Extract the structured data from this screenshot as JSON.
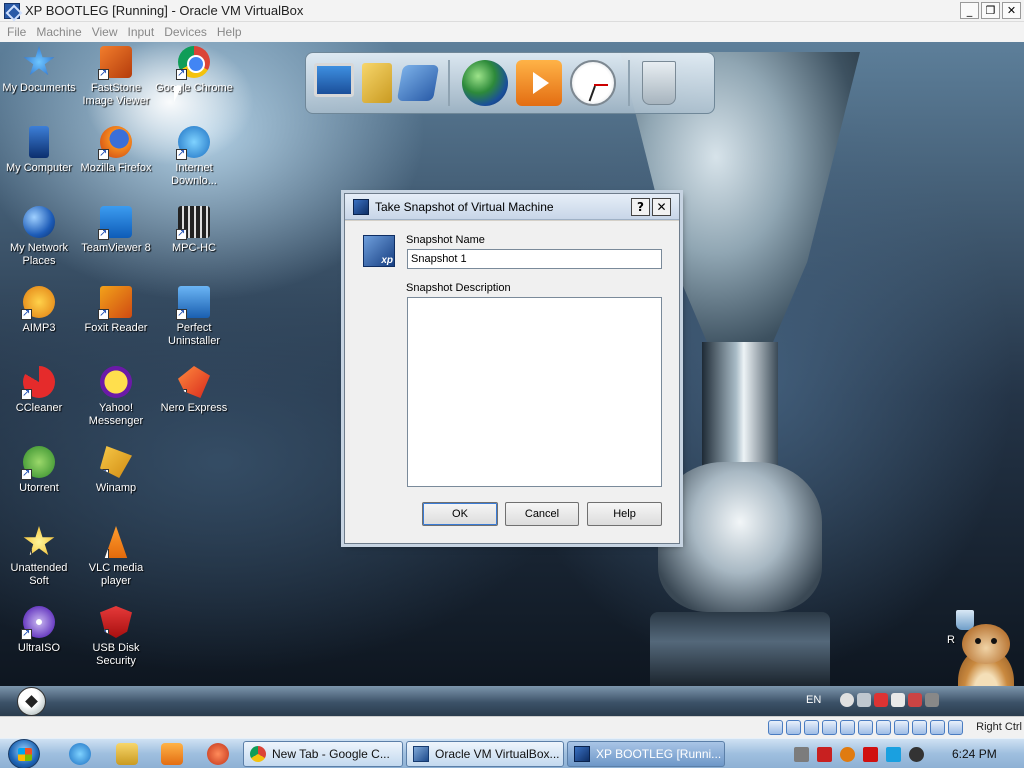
{
  "window": {
    "title": "XP BOOTLEG [Running] - Oracle VM VirtualBox",
    "minimize": "_",
    "restore": "❐",
    "close": "✕"
  },
  "menu": [
    "File",
    "Machine",
    "View",
    "Input",
    "Devices",
    "Help"
  ],
  "desktop_icons": [
    {
      "label": "My Documents",
      "icon": "my-documents-icon"
    },
    {
      "label": "FastStone Image Viewer",
      "icon": "faststone-icon"
    },
    {
      "label": "Google Chrome",
      "icon": "chrome-icon"
    },
    {
      "label": "My Computer",
      "icon": "my-computer-icon"
    },
    {
      "label": "Mozilla Firefox",
      "icon": "firefox-icon"
    },
    {
      "label": "Internet Downlo...",
      "icon": "internet-download-manager-icon"
    },
    {
      "label": "My Network Places",
      "icon": "network-places-icon"
    },
    {
      "label": "TeamViewer 8",
      "icon": "teamviewer-icon"
    },
    {
      "label": "MPC-HC",
      "icon": "mpc-hc-icon"
    },
    {
      "label": "AIMP3",
      "icon": "aimp-icon"
    },
    {
      "label": "Foxit Reader",
      "icon": "foxit-icon"
    },
    {
      "label": "Perfect Uninstaller",
      "icon": "perfect-uninstaller-icon"
    },
    {
      "label": "CCleaner",
      "icon": "ccleaner-icon"
    },
    {
      "label": "Yahoo! Messenger",
      "icon": "yahoo-messenger-icon"
    },
    {
      "label": "Nero Express",
      "icon": "nero-icon"
    },
    {
      "label": "Utorrent",
      "icon": "utorrent-icon"
    },
    {
      "label": "Winamp",
      "icon": "winamp-icon"
    },
    {
      "label": "Unattended Soft",
      "icon": "unattended-soft-icon"
    },
    {
      "label": "VLC media player",
      "icon": "vlc-icon"
    },
    {
      "label": "UltraISO",
      "icon": "ultraiso-icon"
    },
    {
      "label": "USB Disk Security",
      "icon": "usb-disk-security-icon"
    },
    {
      "label": "R",
      "icon": "recycle-bin-icon"
    }
  ],
  "dialog": {
    "title": "Take Snapshot of Virtual Machine",
    "help_glyph": "?",
    "close_glyph": "✕",
    "logo_text": "xp",
    "snapshot_name_label": "Snapshot Name",
    "snapshot_name_value": "Snapshot 1",
    "snapshot_description_label": "Snapshot Description",
    "snapshot_description_value": "",
    "ok_label": "OK",
    "cancel_label": "Cancel",
    "help_label": "Help"
  },
  "guest_tray": {
    "language": "EN"
  },
  "vbox_status": {
    "host_key": "Right Ctrl"
  },
  "taskbar": {
    "buttons": [
      {
        "label": "New Tab - Google C...",
        "icon": "chrome-icon",
        "active": false
      },
      {
        "label": "Oracle VM VirtualBox...",
        "icon": "virtualbox-icon",
        "active": false
      },
      {
        "label": "XP BOOTLEG [Runni...",
        "icon": "xp-vm-icon",
        "active": true
      }
    ],
    "clock": "6:24 PM"
  }
}
